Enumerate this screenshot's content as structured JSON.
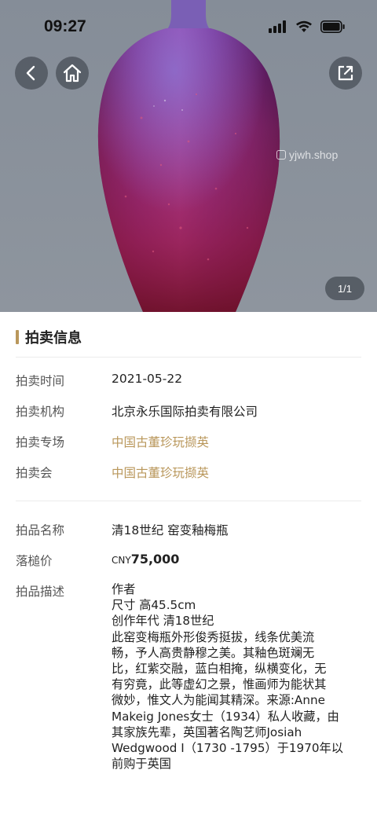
{
  "status_bar": {
    "time": "09:27"
  },
  "hero": {
    "watermark": "yjwh.shop",
    "image_counter": "1/1",
    "icons": {
      "back": "chevron-left-icon",
      "home": "home-icon",
      "share": "share-icon"
    }
  },
  "auction_info": {
    "section_title": "拍卖信息",
    "rows": [
      {
        "label": "拍卖时间",
        "value": "2021-05-22"
      },
      {
        "label": "拍卖机构",
        "value": "北京永乐国际拍卖有限公司"
      },
      {
        "label": "拍卖专场",
        "value": "中国古董珍玩撷英"
      },
      {
        "label": "拍卖会",
        "value": "中国古董珍玩撷英"
      }
    ]
  },
  "lot": {
    "name_label": "拍品名称",
    "name": "清18世纪 窑变釉梅瓶",
    "price_label": "落槌价",
    "price_currency": "CNY",
    "price_amount": "75,000",
    "desc_label": "拍品描述",
    "desc_lines": [
      "作者",
      "尺寸 高45.5cm",
      "创作年代 清18世纪",
      "此窑变梅瓶外形俊秀挺拔，线条优美流",
      "畅，予人高贵静穆之美。其釉色斑斓无",
      "比，红紫交融，蓝白相掩，纵横变化，无",
      "有穷竟，此等虚幻之景，惟画师为能状其",
      "微妙，惟文人为能闻其精深。来源:Anne",
      "Makeig Jones女士（1934）私人收藏，由",
      "其家族先辈，英国著名陶艺师Josiah",
      "Wedgwood I（1730 -1795）于1970年以",
      "前购于英国"
    ]
  },
  "colors": {
    "accent_gold": "#b9975b",
    "price_red": "#c21a2a",
    "hero_bg": "#8a929c"
  }
}
